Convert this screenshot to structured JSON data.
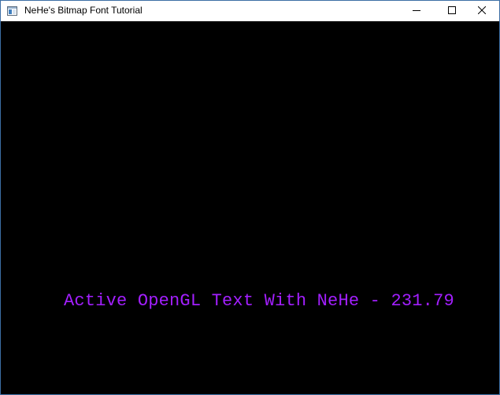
{
  "window": {
    "title": "NeHe's Bitmap Font Tutorial",
    "icon": "app-window-icon",
    "controls": {
      "minimize_icon": "minimize-icon",
      "maximize_icon": "maximize-icon",
      "close_icon": "close-icon"
    }
  },
  "canvas": {
    "background_color": "#000000",
    "text": {
      "label": "Active OpenGL Text With NeHe - ",
      "value": "231.79",
      "color": "#a31fff"
    }
  }
}
